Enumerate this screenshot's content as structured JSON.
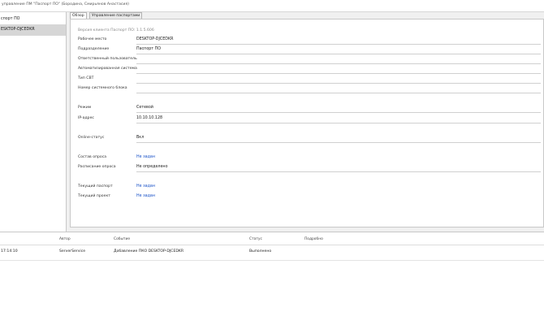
{
  "window": {
    "title": "управление ПМ \"Паспорт ПО\" (Бородина, Смирьянов Анастасия)"
  },
  "sidebar": {
    "items": [
      {
        "label": "спорт ПО",
        "selected": false
      },
      {
        "label": "ESKTOP-DJCEDKR",
        "selected": true
      }
    ]
  },
  "tabs": [
    {
      "label": "Обзор",
      "active": true
    },
    {
      "label": "Управление паспортами",
      "active": false
    }
  ],
  "overview": {
    "version": "Версия клиента Паспорт ПО: 1.1.5.606",
    "fields": [
      {
        "label": "Рабочее место",
        "value": "DESKTOP-DJCEDKR",
        "link": false,
        "line": true
      },
      {
        "label": "Подразделение",
        "value": "Паспорт ПО",
        "link": false,
        "line": true
      },
      {
        "label": "Ответственный пользователь",
        "value": "",
        "link": false,
        "line": true
      },
      {
        "label": "Автоматизированная система",
        "value": "",
        "link": false,
        "line": true
      },
      {
        "label": "Тип СВТ",
        "value": "",
        "link": false,
        "line": true
      },
      {
        "label": "Номер системного блока",
        "value": "",
        "link": false,
        "line": true
      },
      {
        "label": "Режим",
        "value": "Сетевой",
        "link": false,
        "line": true
      },
      {
        "label": "IP-адрес",
        "value": "10.10.10.128",
        "link": false,
        "line": true
      },
      {
        "label": "Online-статус",
        "value": "Вкл",
        "link": false,
        "line": true
      },
      {
        "label": "Состав опроса",
        "value": "Не задан",
        "link": true,
        "line": false
      },
      {
        "label": "Расписание опроса",
        "value": "Не определено",
        "link": false,
        "line": true
      },
      {
        "label": "Текущий паспорт",
        "value": "Не задан",
        "link": true,
        "line": false
      },
      {
        "label": "Текущий проект",
        "value": "Не задан",
        "link": true,
        "line": false
      }
    ]
  },
  "log": {
    "columns": [
      "Автор",
      "Событие",
      "Статус",
      "Подробно"
    ],
    "rows": [
      {
        "time": "17:14:10",
        "author": "ServerService",
        "event": "Добавление ПКО DESKTOP-DJCEDKR",
        "status": "Выполнено",
        "details": ""
      }
    ]
  }
}
